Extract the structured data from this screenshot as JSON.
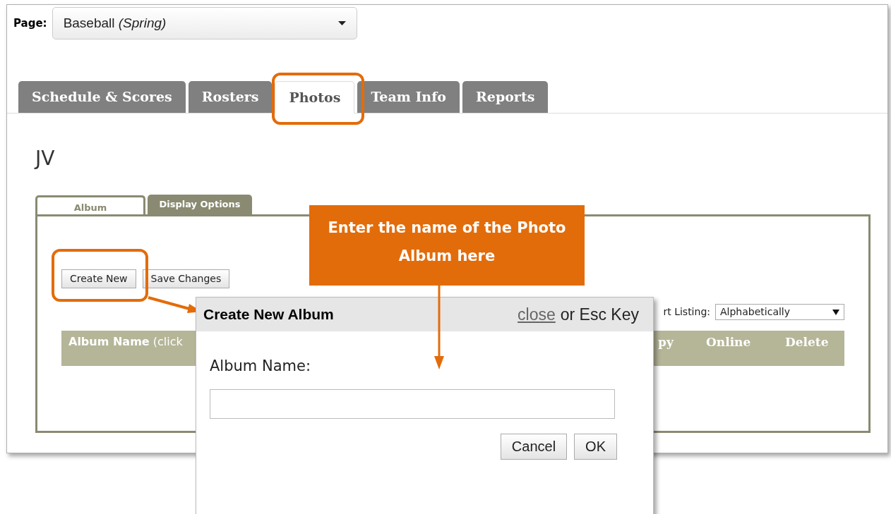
{
  "page_selector": {
    "label": "Page:",
    "value": "Baseball *(Spring)*"
  },
  "tabs": [
    {
      "label": "Schedule & Scores",
      "selected": false
    },
    {
      "label": "Rosters",
      "selected": false
    },
    {
      "label": "Photos",
      "selected": true
    },
    {
      "label": "Team Info",
      "selected": false
    },
    {
      "label": "Reports",
      "selected": false
    }
  ],
  "heading": "JV",
  "subtabs": [
    {
      "label": "Album",
      "selected": true
    },
    {
      "label": "Display Options",
      "selected": false
    }
  ],
  "buttons": [
    "Create New",
    "Save Changes"
  ],
  "sort": {
    "label": "rt Listing:",
    "value": "Alphabetically"
  },
  "table": {
    "columns": [
      "**Album Name** (click",
      "py",
      "Online",
      "Delete"
    ]
  },
  "dialog": {
    "title": "Create New Album",
    "close_link": "close",
    "close_hint": "or Esc Key",
    "field_label": "Album Name:",
    "buttons": [
      "Cancel",
      "OK"
    ]
  },
  "callout": {
    "text": "Enter the name of the Photo Album here"
  }
}
